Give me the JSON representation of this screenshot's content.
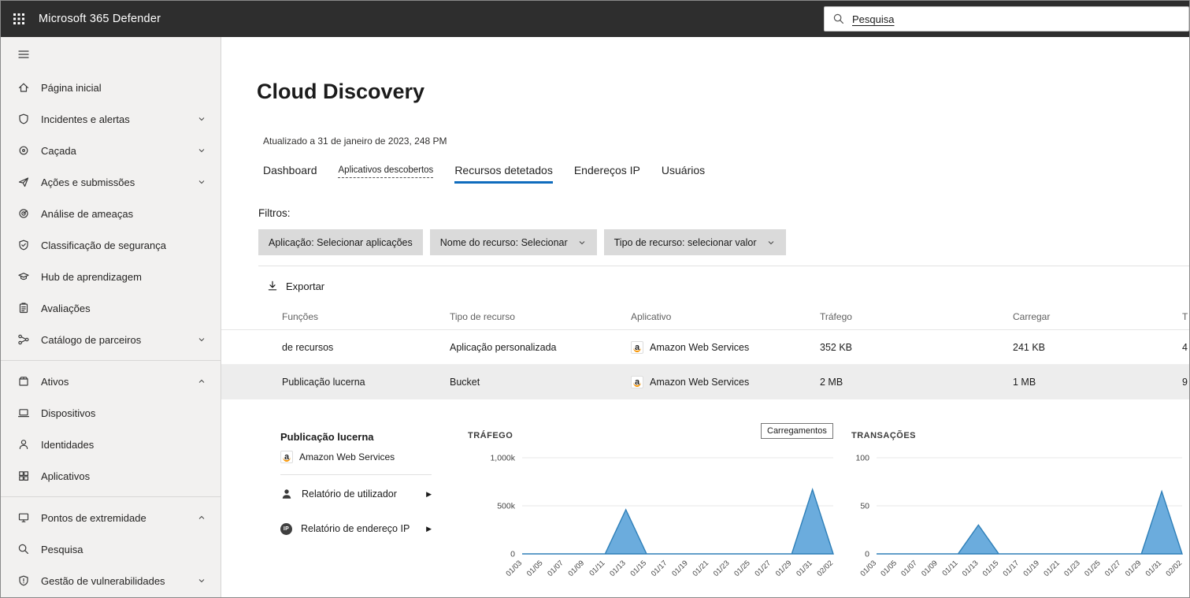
{
  "topbar": {
    "app_title": "Microsoft 365 Defender",
    "search_placeholder": "Pesquisa"
  },
  "sidebar": {
    "items": [
      {
        "label": "Página inicial"
      },
      {
        "label": "Incidentes e alertas"
      },
      {
        "label": "Caçada"
      },
      {
        "label": "Ações e submissões"
      },
      {
        "label": "Análise de ameaças"
      },
      {
        "label": "Classificação de segurança"
      },
      {
        "label": "Hub de aprendizagem"
      },
      {
        "label": "Avaliações"
      },
      {
        "label": "Catálogo de parceiros"
      },
      {
        "label": "Ativos"
      },
      {
        "label": "Dispositivos"
      },
      {
        "label": "Identidades"
      },
      {
        "label": "Aplicativos"
      },
      {
        "label": "Pontos de extremidade"
      },
      {
        "label": "Pesquisa"
      },
      {
        "label": "Gestão de vulnerabilidades"
      }
    ]
  },
  "page": {
    "title": "Cloud Discovery",
    "updated": "Atualizado a 31 de janeiro de 2023, 248 PM"
  },
  "tabs": [
    {
      "label": "Dashboard"
    },
    {
      "label": "Aplicativos descobertos"
    },
    {
      "label": "Recursos detetados"
    },
    {
      "label": "Endereços IP"
    },
    {
      "label": "Usuários"
    }
  ],
  "filters": {
    "label": "Filtros:",
    "chips": [
      {
        "label": "Aplicação: Selecionar aplicações"
      },
      {
        "label": "Nome do recurso:  Selecionar"
      },
      {
        "label": "Tipo de recurso: selecionar valor"
      }
    ]
  },
  "toolbar": {
    "export_label": "Exportar"
  },
  "table": {
    "columns": [
      "Funções",
      "Tipo de recurso",
      "Aplicativo",
      "Tráfego",
      "Carregar",
      "T"
    ],
    "rows": [
      {
        "funcoes": "de recursos",
        "tipo": "Aplicação personalizada",
        "app": "Amazon Web Services",
        "trafego": "352 KB",
        "carregar": "241 KB",
        "extra": "4"
      },
      {
        "funcoes": "Publicação lucerna",
        "tipo": "Bucket",
        "app": "Amazon Web Services",
        "trafego": "2 MB",
        "carregar": "1 MB",
        "extra": "9"
      }
    ]
  },
  "detail": {
    "resource_name": "Publicação lucerna",
    "app_name": "Amazon Web Services",
    "links": [
      {
        "label": "Relatório de utilizador"
      },
      {
        "label": "Relatório de endereço IP"
      }
    ],
    "tooltip": "Carregamentos"
  },
  "chart_data": [
    {
      "type": "area",
      "title": "TRÁFEGO",
      "x": [
        "01/03",
        "01/05",
        "01/07",
        "01/09",
        "01/11",
        "01/13",
        "01/15",
        "01/17",
        "01/19",
        "01/21",
        "01/23",
        "01/25",
        "01/27",
        "01/29",
        "01/31",
        "02/02"
      ],
      "values": [
        0,
        0,
        0,
        0,
        0,
        460,
        0,
        0,
        0,
        0,
        0,
        0,
        0,
        0,
        670,
        0
      ],
      "unit": "k",
      "ylim": [
        0,
        1000
      ],
      "yticks": [
        {
          "v": 1000,
          "label": "1,000k"
        },
        {
          "v": 500,
          "label": "500k"
        },
        {
          "v": 0,
          "label": "0"
        }
      ],
      "grid": true,
      "legend": "Carregamentos",
      "fill": "#5ba3d9",
      "stroke": "#2e7fb8"
    },
    {
      "type": "area",
      "title": "TRANSAÇÕES",
      "x": [
        "01/03",
        "01/05",
        "01/07",
        "01/09",
        "01/11",
        "01/13",
        "01/15",
        "01/17",
        "01/19",
        "01/21",
        "01/23",
        "01/25",
        "01/27",
        "01/29",
        "01/31",
        "02/02"
      ],
      "values": [
        0,
        0,
        0,
        0,
        0,
        30,
        0,
        0,
        0,
        0,
        0,
        0,
        0,
        0,
        65,
        0
      ],
      "ylim": [
        0,
        100
      ],
      "yticks": [
        {
          "v": 100,
          "label": "100"
        },
        {
          "v": 50,
          "label": "50"
        },
        {
          "v": 0,
          "label": "0"
        }
      ],
      "grid": true,
      "fill": "#5ba3d9",
      "stroke": "#2e7fb8"
    }
  ]
}
